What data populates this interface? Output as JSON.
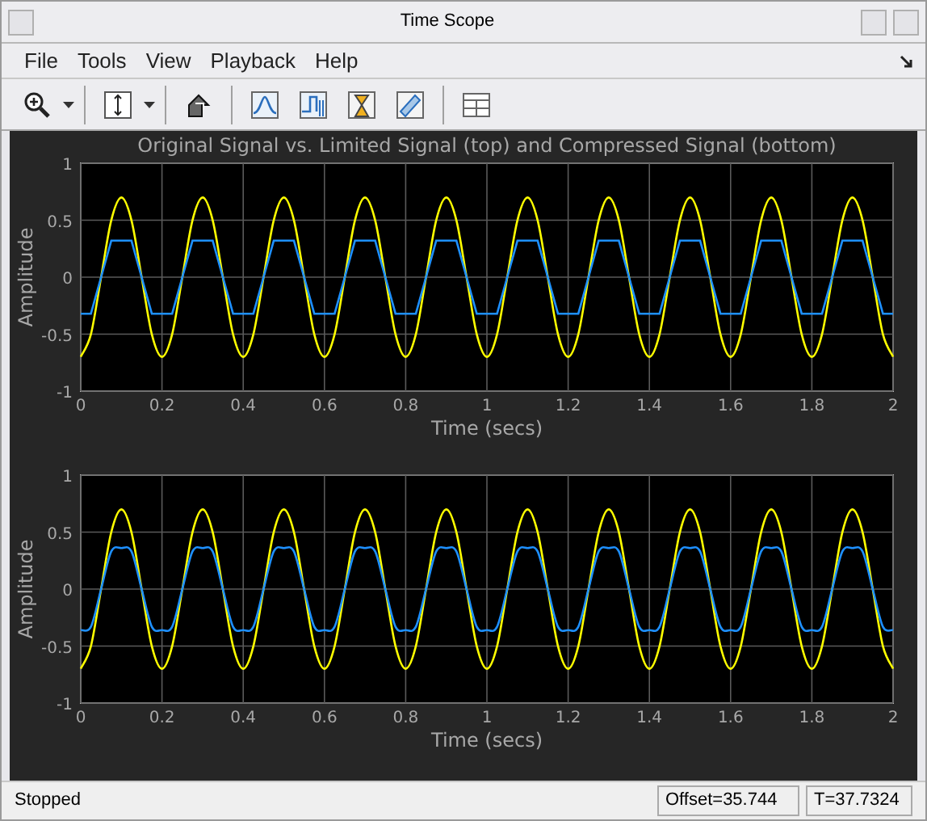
{
  "window": {
    "title": "Time Scope"
  },
  "menu": [
    {
      "label": "File"
    },
    {
      "label": "Tools"
    },
    {
      "label": "View"
    },
    {
      "label": "Playback"
    },
    {
      "label": "Help"
    }
  ],
  "plots": [
    {
      "chart_data": {
        "type": "line",
        "title": "Original Signal vs. Limited Signal (top) and Compressed Signal (bottom)",
        "xlabel": "Time (secs)",
        "ylabel": "Amplitude",
        "grid": true,
        "x": [
          0,
          0.025,
          0.05,
          0.075,
          0.1,
          0.125,
          0.15,
          0.175,
          0.2,
          0.225,
          0.25,
          0.275,
          0.3,
          0.325,
          0.35,
          0.375,
          0.4,
          0.425,
          0.45,
          0.475,
          0.5,
          0.525,
          0.55,
          0.575,
          0.6,
          0.625,
          0.65,
          0.675,
          0.7,
          0.725,
          0.75,
          0.775,
          0.8,
          0.825,
          0.85,
          0.875,
          0.9,
          0.925,
          0.95,
          0.975,
          1,
          1.025,
          1.05,
          1.075,
          1.1,
          1.125,
          1.15,
          1.175,
          1.2,
          1.225,
          1.25,
          1.275,
          1.3,
          1.325,
          1.35,
          1.375,
          1.4,
          1.425,
          1.45,
          1.475,
          1.5,
          1.525,
          1.55,
          1.575,
          1.6,
          1.625,
          1.65,
          1.675,
          1.7,
          1.725,
          1.75,
          1.775,
          1.8,
          1.825,
          1.85,
          1.875,
          1.9,
          1.925,
          1.95,
          1.975,
          2
        ],
        "xlim": [
          0,
          2
        ],
        "ylim": [
          -1,
          1
        ],
        "xticks": [
          {
            "value": 0,
            "label": "0"
          },
          {
            "value": 0.2,
            "label": "0.2"
          },
          {
            "value": 0.4,
            "label": "0.4"
          },
          {
            "value": 0.6,
            "label": "0.6"
          },
          {
            "value": 0.8,
            "label": "0.8"
          },
          {
            "value": 1,
            "label": "1"
          },
          {
            "value": 1.2,
            "label": "1.2"
          },
          {
            "value": 1.4,
            "label": "1.4"
          },
          {
            "value": 1.6,
            "label": "1.6"
          },
          {
            "value": 1.8,
            "label": "1.8"
          },
          {
            "value": 2,
            "label": "2"
          }
        ],
        "yticks": [
          {
            "value": -1,
            "label": "-1"
          },
          {
            "value": -0.5,
            "label": "-0.5"
          },
          {
            "value": 0,
            "label": "0"
          },
          {
            "value": 0.5,
            "label": "0.5"
          },
          {
            "value": 1,
            "label": "1"
          }
        ],
        "series": [
          {
            "color": "#ffff00",
            "values": [
              -0.7,
              -0.5,
              0,
              0.5,
              0.7,
              0.5,
              0,
              -0.5,
              -0.7,
              -0.5,
              0,
              0.5,
              0.7,
              0.5,
              0,
              -0.5,
              -0.7,
              -0.5,
              0,
              0.5,
              0.7,
              0.5,
              0,
              -0.5,
              -0.7,
              -0.5,
              0,
              0.5,
              0.7,
              0.5,
              0,
              -0.5,
              -0.7,
              -0.5,
              0,
              0.5,
              0.7,
              0.5,
              0,
              -0.5,
              -0.7,
              -0.5,
              0,
              0.5,
              0.7,
              0.5,
              0,
              -0.5,
              -0.7,
              -0.5,
              0,
              0.5,
              0.7,
              0.5,
              0,
              -0.5,
              -0.7,
              -0.5,
              0,
              0.5,
              0.7,
              0.5,
              0,
              -0.5,
              -0.7,
              -0.5,
              0,
              0.5,
              0.7,
              0.5,
              0,
              -0.5,
              -0.7,
              -0.5,
              0,
              0.5,
              0.7,
              0.5,
              0,
              -0.5,
              -0.7
            ]
          },
          {
            "color": "#1e90ff",
            "values": [
              -0.32,
              -0.32,
              0,
              0.32,
              0.32,
              0.32,
              0,
              -0.32,
              -0.32,
              -0.32,
              0,
              0.32,
              0.32,
              0.32,
              0,
              -0.32,
              -0.32,
              -0.32,
              0,
              0.32,
              0.32,
              0.32,
              0,
              -0.32,
              -0.32,
              -0.32,
              0,
              0.32,
              0.32,
              0.32,
              0,
              -0.32,
              -0.32,
              -0.32,
              0,
              0.32,
              0.32,
              0.32,
              0,
              -0.32,
              -0.32,
              -0.32,
              0,
              0.32,
              0.32,
              0.32,
              0,
              -0.32,
              -0.32,
              -0.32,
              0,
              0.32,
              0.32,
              0.32,
              0,
              -0.32,
              -0.32,
              -0.32,
              0,
              0.32,
              0.32,
              0.32,
              0,
              -0.32,
              -0.32,
              -0.32,
              0,
              0.32,
              0.32,
              0.32,
              0,
              -0.32,
              -0.32,
              -0.32,
              0,
              0.32,
              0.32,
              0.32,
              0,
              -0.32,
              -0.32
            ]
          }
        ]
      }
    },
    {
      "chart_data": {
        "type": "line",
        "xlabel": "Time (secs)",
        "ylabel": "Amplitude",
        "grid": true,
        "x": [
          0,
          0.025,
          0.05,
          0.075,
          0.1,
          0.125,
          0.15,
          0.175,
          0.2,
          0.225,
          0.25,
          0.275,
          0.3,
          0.325,
          0.35,
          0.375,
          0.4,
          0.425,
          0.45,
          0.475,
          0.5,
          0.525,
          0.55,
          0.575,
          0.6,
          0.625,
          0.65,
          0.675,
          0.7,
          0.725,
          0.75,
          0.775,
          0.8,
          0.825,
          0.85,
          0.875,
          0.9,
          0.925,
          0.95,
          0.975,
          1,
          1.025,
          1.05,
          1.075,
          1.1,
          1.125,
          1.15,
          1.175,
          1.2,
          1.225,
          1.25,
          1.275,
          1.3,
          1.325,
          1.35,
          1.375,
          1.4,
          1.425,
          1.45,
          1.475,
          1.5,
          1.525,
          1.55,
          1.575,
          1.6,
          1.625,
          1.65,
          1.675,
          1.7,
          1.725,
          1.75,
          1.775,
          1.8,
          1.825,
          1.85,
          1.875,
          1.9,
          1.925,
          1.95,
          1.975,
          2
        ],
        "xlim": [
          0,
          2
        ],
        "ylim": [
          -1,
          1
        ],
        "xticks": [
          {
            "value": 0,
            "label": "0"
          },
          {
            "value": 0.2,
            "label": "0.2"
          },
          {
            "value": 0.4,
            "label": "0.4"
          },
          {
            "value": 0.6,
            "label": "0.6"
          },
          {
            "value": 0.8,
            "label": "0.8"
          },
          {
            "value": 1,
            "label": "1"
          },
          {
            "value": 1.2,
            "label": "1.2"
          },
          {
            "value": 1.4,
            "label": "1.4"
          },
          {
            "value": 1.6,
            "label": "1.6"
          },
          {
            "value": 1.8,
            "label": "1.8"
          },
          {
            "value": 2,
            "label": "2"
          }
        ],
        "yticks": [
          {
            "value": -1,
            "label": "-1"
          },
          {
            "value": -0.5,
            "label": "-0.5"
          },
          {
            "value": 0,
            "label": "0"
          },
          {
            "value": 0.5,
            "label": "0.5"
          },
          {
            "value": 1,
            "label": "1"
          }
        ],
        "series": [
          {
            "color": "#ffff00",
            "values": [
              -0.7,
              -0.5,
              0,
              0.5,
              0.7,
              0.5,
              0,
              -0.5,
              -0.7,
              -0.5,
              0,
              0.5,
              0.7,
              0.5,
              0,
              -0.5,
              -0.7,
              -0.5,
              0,
              0.5,
              0.7,
              0.5,
              0,
              -0.5,
              -0.7,
              -0.5,
              0,
              0.5,
              0.7,
              0.5,
              0,
              -0.5,
              -0.7,
              -0.5,
              0,
              0.5,
              0.7,
              0.5,
              0,
              -0.5,
              -0.7,
              -0.5,
              0,
              0.5,
              0.7,
              0.5,
              0,
              -0.5,
              -0.7,
              -0.5,
              0,
              0.5,
              0.7,
              0.5,
              0,
              -0.5,
              -0.7,
              -0.5,
              0,
              0.5,
              0.7,
              0.5,
              0,
              -0.5,
              -0.7,
              -0.5,
              0,
              0.5,
              0.7,
              0.5,
              0,
              -0.5,
              -0.7,
              -0.5,
              0,
              0.5,
              0.7,
              0.5,
              0,
              -0.5,
              -0.7
            ]
          },
          {
            "color": "#1e90ff",
            "values": [
              -0.36,
              -0.33,
              0,
              0.33,
              0.36,
              0.33,
              0,
              -0.33,
              -0.36,
              -0.33,
              0,
              0.33,
              0.36,
              0.33,
              0,
              -0.33,
              -0.36,
              -0.33,
              0,
              0.33,
              0.36,
              0.33,
              0,
              -0.33,
              -0.36,
              -0.33,
              0,
              0.33,
              0.36,
              0.33,
              0,
              -0.33,
              -0.36,
              -0.33,
              0,
              0.33,
              0.36,
              0.33,
              0,
              -0.33,
              -0.36,
              -0.33,
              0,
              0.33,
              0.36,
              0.33,
              0,
              -0.33,
              -0.36,
              -0.33,
              0,
              0.33,
              0.36,
              0.33,
              0,
              -0.33,
              -0.36,
              -0.33,
              0,
              0.33,
              0.36,
              0.33,
              0,
              -0.33,
              -0.36,
              -0.33,
              0,
              0.33,
              0.36,
              0.33,
              0,
              -0.33,
              -0.36,
              -0.33,
              0,
              0.33,
              0.36,
              0.33,
              0,
              -0.33,
              -0.36
            ]
          }
        ]
      }
    }
  ],
  "status_bar": {
    "state": "Stopped",
    "offset": "Offset=35.744",
    "time": "T=37.7324"
  }
}
